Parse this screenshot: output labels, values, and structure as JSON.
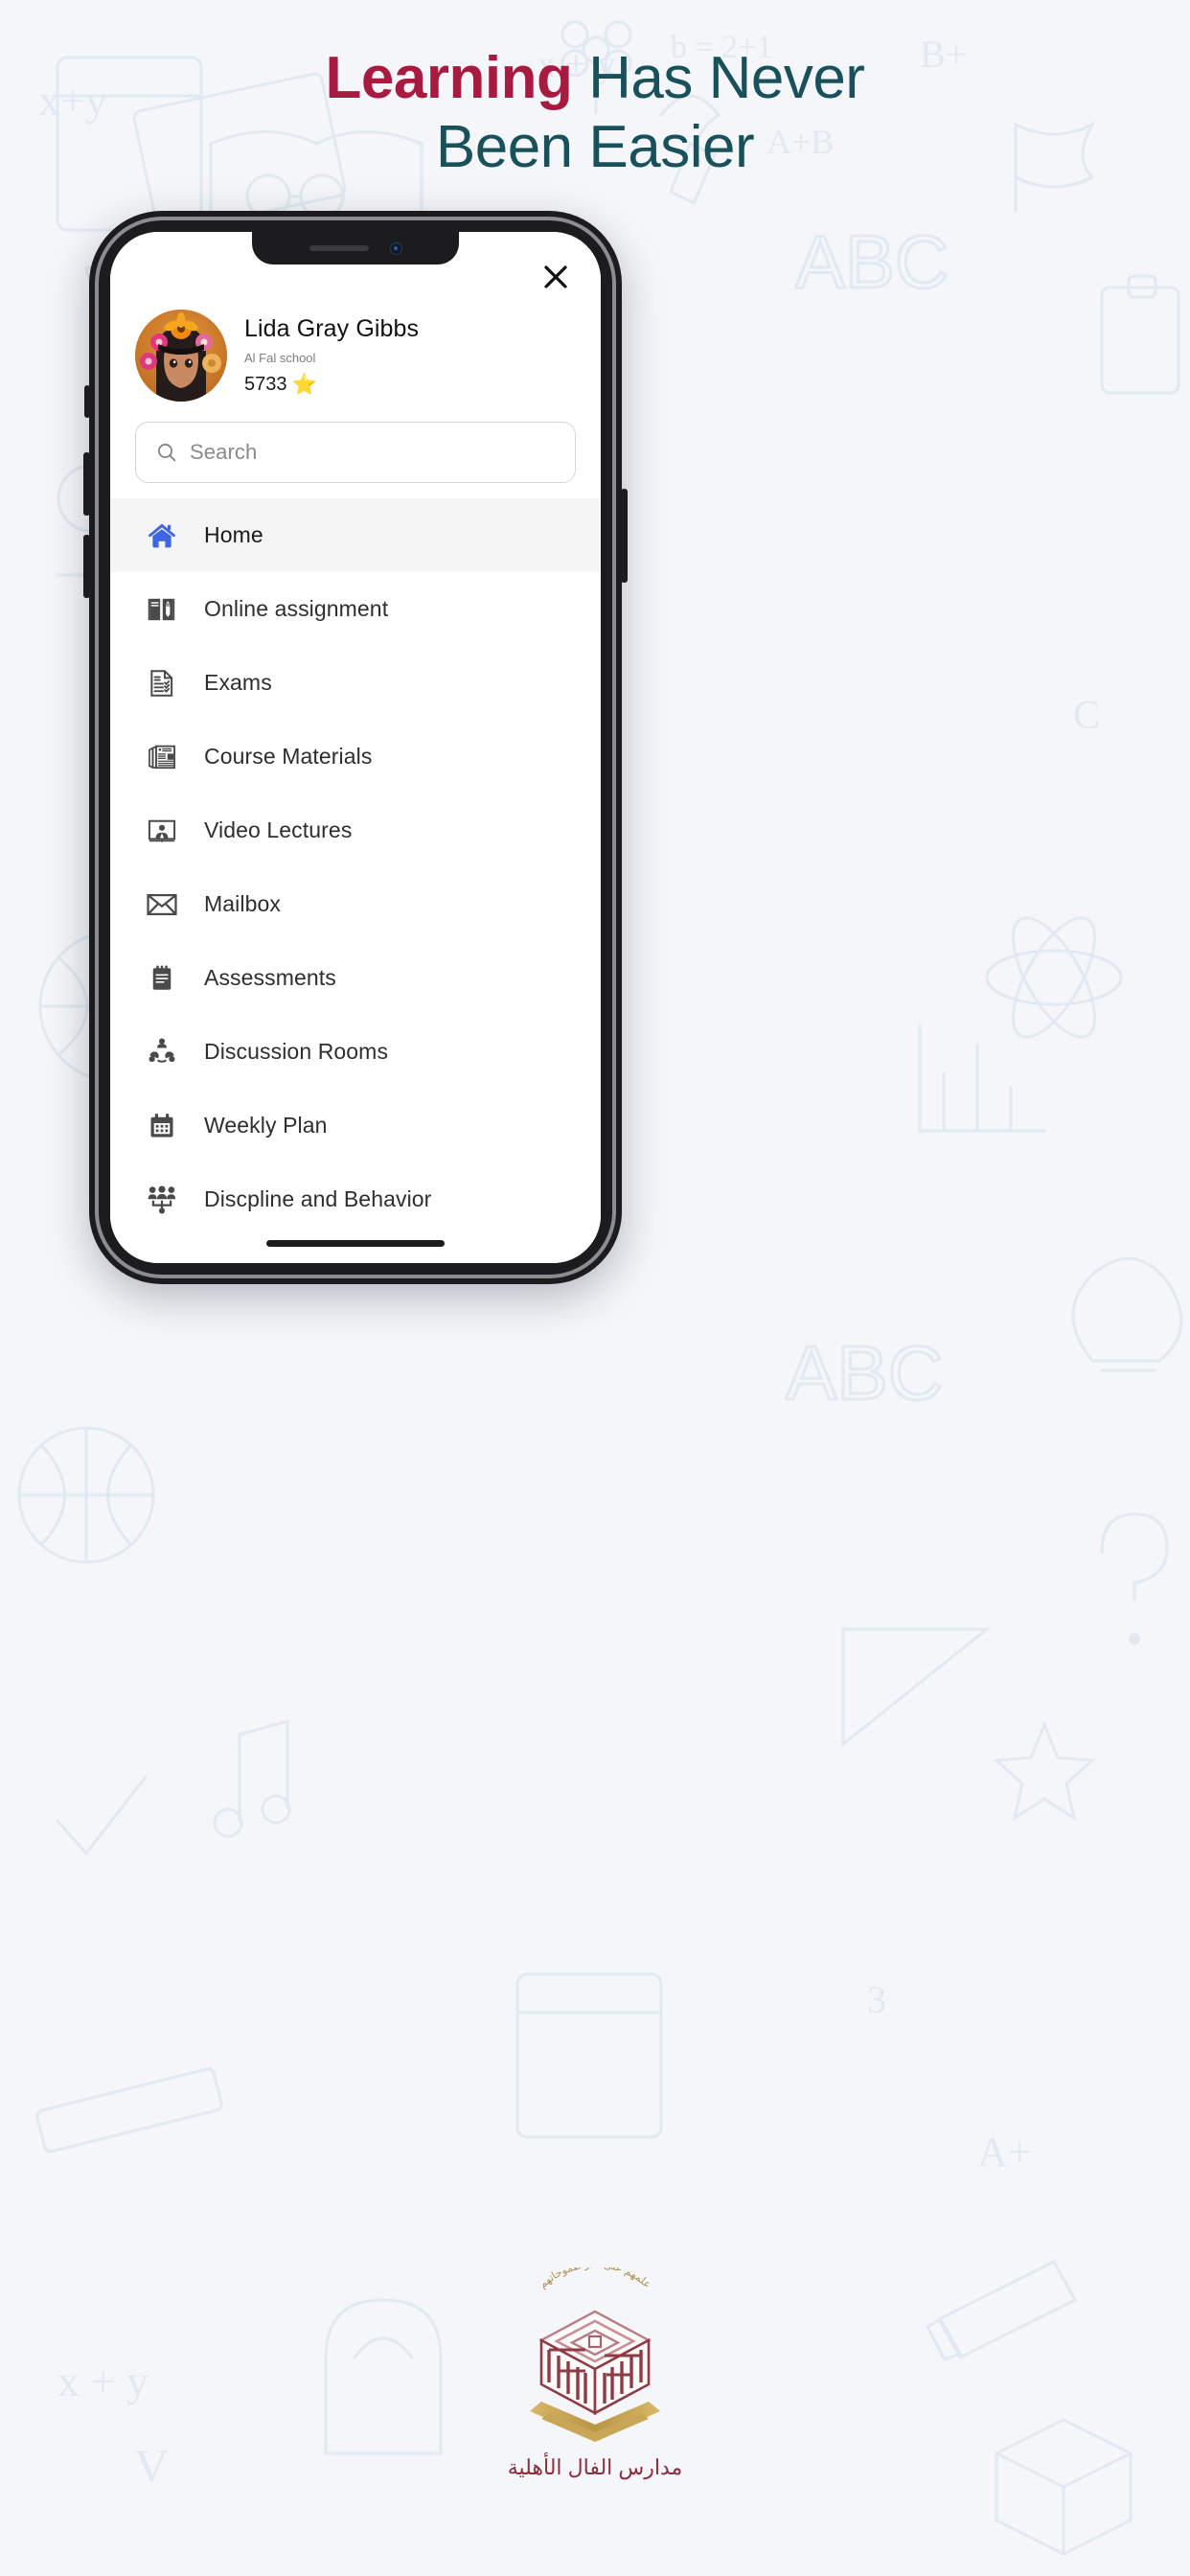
{
  "page": {
    "background_color": "#f4f6f9",
    "headline_accent_color": "#a81b40",
    "headline_rest_color": "#18505c"
  },
  "headline": {
    "accent": "Learning",
    "rest_line1": " Has Never",
    "line2": "Been Easier"
  },
  "app": {
    "close_label": "✕",
    "profile": {
      "name": "Lida Gray Gibbs",
      "school": "Al Fal school",
      "points": "5733",
      "star": "⭐"
    },
    "search": {
      "placeholder": "Search",
      "value": ""
    },
    "menu": [
      {
        "label": "Home",
        "icon": "home-icon",
        "active": true
      },
      {
        "label": "Online assignment",
        "icon": "book-pencil-icon",
        "active": false
      },
      {
        "label": "Exams",
        "icon": "checklist-doc-icon",
        "active": false
      },
      {
        "label": "Course Materials",
        "icon": "newspaper-icon",
        "active": false
      },
      {
        "label": "Video Lectures",
        "icon": "monitor-person-icon",
        "active": false
      },
      {
        "label": "Mailbox",
        "icon": "envelope-icon",
        "active": false
      },
      {
        "label": "Assessments",
        "icon": "notepad-icon",
        "active": false
      },
      {
        "label": "Discussion Rooms",
        "icon": "people-network-icon",
        "active": false
      },
      {
        "label": "Weekly Plan",
        "icon": "calendar-icon",
        "active": false
      },
      {
        "label": "Discpline and Behavior",
        "icon": "group-hierarchy-icon",
        "active": false
      }
    ],
    "active_icon_color": "#3f66df",
    "icon_color": "#4a4a4a"
  },
  "footer": {
    "logo_name": "al-fal-schools-logo",
    "arabic_caption": "مدارس الفال الأهلية",
    "logo_arc_text": "علمهم على قدر طموحاتهم"
  }
}
